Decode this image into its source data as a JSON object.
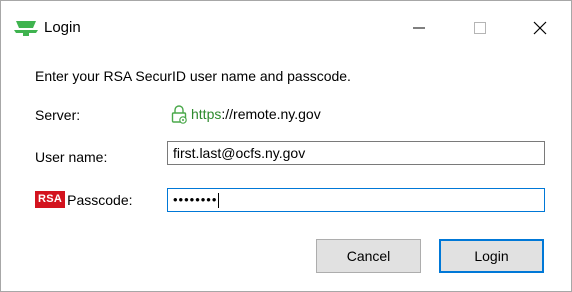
{
  "window": {
    "title": "Login",
    "controls": {
      "minimize": "minimize-icon",
      "maximize": "maximize-icon",
      "close": "close-icon"
    }
  },
  "form": {
    "prompt": "Enter your RSA SecurID user name and passcode.",
    "server": {
      "label": "Server:",
      "scheme": "https",
      "rest": "://remote.ny.gov",
      "icon": "lock-icon"
    },
    "username": {
      "label": "User name:",
      "value": "first.last@ocfs.ny.gov"
    },
    "passcode": {
      "logo_text": "RSA",
      "label": "Passcode:",
      "masked_value": "••••••••"
    }
  },
  "buttons": {
    "cancel": "Cancel",
    "login": "Login"
  },
  "colors": {
    "focus": "#0078d7",
    "rsa_red": "#d3131e",
    "https_green": "#2e8b2e",
    "app_icon_green": "#3fb34f"
  }
}
